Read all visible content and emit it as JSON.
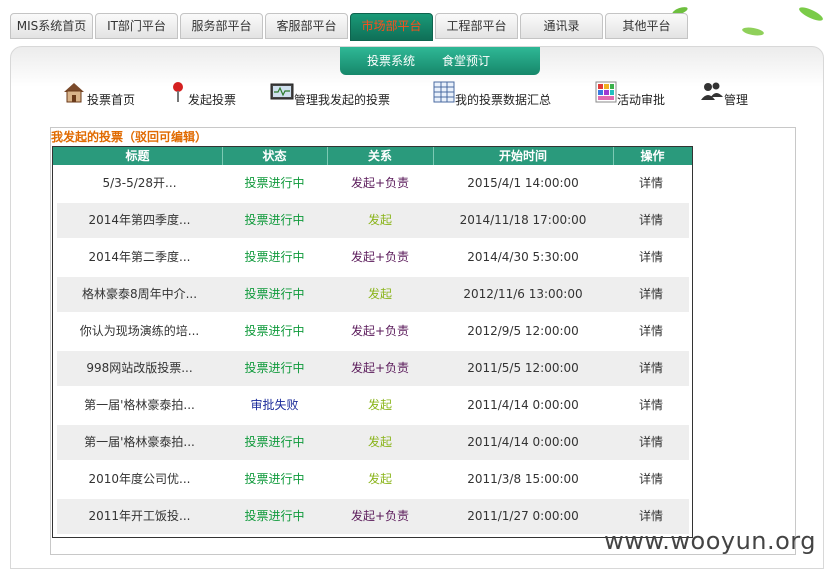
{
  "topnav": [
    {
      "label": "MIS系统首页",
      "active": false
    },
    {
      "label": "IT部门平台",
      "active": false
    },
    {
      "label": "服务部平台",
      "active": false
    },
    {
      "label": "客服部平台",
      "active": false
    },
    {
      "label": "市场部平台",
      "active": true
    },
    {
      "label": "工程部平台",
      "active": false
    },
    {
      "label": "通讯录",
      "active": false
    },
    {
      "label": "其他平台",
      "active": false
    }
  ],
  "subnav": [
    "投票系统",
    "食堂预订"
  ],
  "toolbar": [
    {
      "label": "投票首页",
      "icon": "house-icon"
    },
    {
      "label": "发起投票",
      "icon": "pin-icon"
    },
    {
      "label": "管理我发起的投票",
      "icon": "monitor-icon"
    },
    {
      "label": "我的投票数据汇总",
      "icon": "spreadsheet-icon"
    },
    {
      "label": "活动审批",
      "icon": "palette-icon"
    },
    {
      "label": "管理",
      "icon": "users-icon"
    }
  ],
  "section_title": "我发起的投票（驳回可编辑）",
  "table": {
    "headers": [
      "标题",
      "状态",
      "关系",
      "开始时间",
      "操作"
    ],
    "rows": [
      {
        "title": "5/3-5/28开...",
        "status": "投票进行中",
        "relation": "发起+负责",
        "start": "2015/4/1 14:00:00",
        "action": "详情"
      },
      {
        "title": "2014年第四季度...",
        "status": "投票进行中",
        "relation": "发起",
        "start": "2014/11/18 17:00:00",
        "action": "详情"
      },
      {
        "title": "2014年第二季度...",
        "status": "投票进行中",
        "relation": "发起+负责",
        "start": "2014/4/30 5:30:00",
        "action": "详情"
      },
      {
        "title": "格林豪泰8周年中介...",
        "status": "投票进行中",
        "relation": "发起",
        "start": "2012/11/6 13:00:00",
        "action": "详情"
      },
      {
        "title": "你认为现场演练的培...",
        "status": "投票进行中",
        "relation": "发起+负责",
        "start": "2012/9/5 12:00:00",
        "action": "详情"
      },
      {
        "title": "998网站改版投票...",
        "status": "投票进行中",
        "relation": "发起+负责",
        "start": "2011/5/5 12:00:00",
        "action": "详情"
      },
      {
        "title": "第一届'格林豪泰拍...",
        "status": "审批失败",
        "relation": "发起",
        "start": "2011/4/14 0:00:00",
        "action": "详情"
      },
      {
        "title": "第一届'格林豪泰拍...",
        "status": "投票进行中",
        "relation": "发起",
        "start": "2011/4/14 0:00:00",
        "action": "详情"
      },
      {
        "title": "2010年度公司优...",
        "status": "投票进行中",
        "relation": "发起",
        "start": "2011/3/8 15:00:00",
        "action": "详情"
      },
      {
        "title": "2011年开工饭投...",
        "status": "投票进行中",
        "relation": "发起+负责",
        "start": "2011/1/27 0:00:00",
        "action": "详情"
      }
    ]
  },
  "watermark": "www.wooyun.org",
  "colors": {
    "accent": "#2a9a7c",
    "active_tab_text": "#ff4d1a",
    "section_title": "#e06a00"
  }
}
